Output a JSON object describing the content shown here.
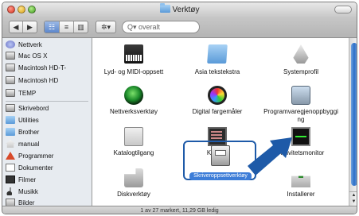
{
  "window": {
    "title": "Verktøy",
    "status": "1 av 27 markert, 11,29 GB ledig"
  },
  "toolbar": {
    "search_placeholder": "overalt",
    "search_glyph": "Q▾",
    "back_label": "◀",
    "forward_label": "▶",
    "view_icon_label": "☷",
    "view_list_label": "≡",
    "view_column_label": "▥",
    "action_label": "✲▾"
  },
  "sidebar": {
    "items": [
      {
        "label": "Nettverk",
        "icon": "network-icon"
      },
      {
        "label": "Mac OS X",
        "icon": "drive-icon"
      },
      {
        "label": "Macintosh HD-T-",
        "icon": "drive-icon"
      },
      {
        "label": "Macintosh HD",
        "icon": "drive-icon"
      },
      {
        "label": "TEMP",
        "icon": "drive-icon"
      },
      {
        "label": "Skrivebord",
        "icon": "desktop-icon"
      },
      {
        "label": "Utilities",
        "icon": "folder-icon"
      },
      {
        "label": "Brother",
        "icon": "folder-icon"
      },
      {
        "label": "manual",
        "icon": "home-icon"
      },
      {
        "label": "Programmer",
        "icon": "applications-icon"
      },
      {
        "label": "Dokumenter",
        "icon": "documents-icon"
      },
      {
        "label": "Filmer",
        "icon": "movies-icon"
      },
      {
        "label": "Musikk",
        "icon": "music-icon"
      },
      {
        "label": "Bilder",
        "icon": "pictures-icon"
      }
    ]
  },
  "files": {
    "items": [
      {
        "label": "Lyd- og MIDI-oppsett",
        "icon": "audio-midi-icon"
      },
      {
        "label": "Asia tekstekstra",
        "icon": "folder-icon"
      },
      {
        "label": "Systemprofil",
        "icon": "system-profiler-icon"
      },
      {
        "label": "Nettverksverktøy",
        "icon": "network-utility-icon"
      },
      {
        "label": "Digital fargemåler",
        "icon": "color-meter-icon"
      },
      {
        "label": "Programvaregjenoppbyggi ng",
        "icon": "software-restore-icon"
      },
      {
        "label": "Katalogtilgang",
        "icon": "directory-access-icon"
      },
      {
        "label": "Konsoll",
        "icon": "console-icon"
      },
      {
        "label": "Aktivitetsmonitor",
        "icon": "activity-monitor-icon"
      },
      {
        "label": "Diskverktøy",
        "icon": "disk-utility-icon"
      },
      {
        "label": "Skriveroppsettverktøy",
        "icon": "printer-setup-icon",
        "selected": true
      },
      {
        "label": "Installerer",
        "icon": "installer-icon"
      }
    ]
  },
  "colors": {
    "selection": "#3d7dd8",
    "highlight_box": "#1e5aa8",
    "arrow": "#1e5aa8"
  }
}
